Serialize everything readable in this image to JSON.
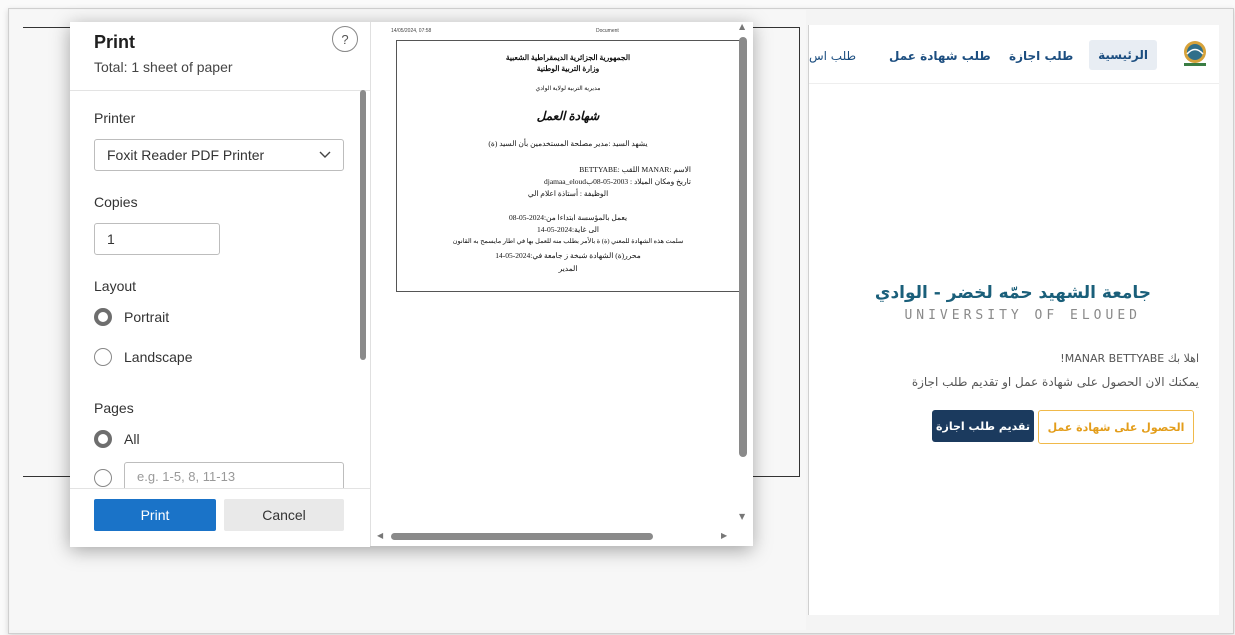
{
  "website": {
    "nav": {
      "home": "الرئيسية",
      "leave_request": "طلب اجازة",
      "work_certificate": "طلب شهادة عمل",
      "truncated_item": "طلب اس"
    },
    "university_name_ar": "جامعة الشهيد حمّه لخضر - الوادي",
    "university_name_en": "UNIVERSITY OF ELOUED",
    "welcome": "اهلا بك MANAR BETTYABE!",
    "subtext": "يمكنك الان الحصول على شهادة عمل او تقديم طلب اجازة",
    "btn_certificate": "الحصول على شهادة عمل",
    "btn_leave": "تقديم طلب اجازة"
  },
  "print_dialog": {
    "title": "Print",
    "total": "Total: 1 sheet of paper",
    "help": "?",
    "printer_label": "Printer",
    "printer_value": "Foxit Reader PDF Printer",
    "copies_label": "Copies",
    "copies_value": "1",
    "layout_label": "Layout",
    "layout_options": [
      "Portrait",
      "Landscape"
    ],
    "layout_selected": "Portrait",
    "pages_label": "Pages",
    "pages_all": "All",
    "pages_placeholder": "e.g. 1-5, 8, 11-13",
    "print_button": "Print",
    "cancel_button": "Cancel"
  },
  "preview": {
    "header_left": "14/05/2024, 07:58",
    "header_center": "Document",
    "lines": [
      "الجمهورية الجزائرية الديمقراطية الشعبية",
      "وزارة التربية الوطنية",
      "مديرية التربية لولاية الوادي",
      "شهادة العمل",
      "يشهد السيد :مدير مصلحة المستخدمين بأن السيد (ة)",
      "الاسم :MANAR اللقب :BETTYABE",
      "تاريخ ومكان الميلاد : 2003-05-08بdjamaa_eloud",
      "الوظيفة : أستاذة اعلام الي",
      "يعمل بالمؤسسة ابتداءا من:2024-05-08",
      "الى غاية:2024-05-14",
      "سلمت هذه الشهادة للمعني (ة) ة بالأمر بطلب منه للعمل بها في اطار مايسمح به القانون",
      "محرر(ة) الشهادة شبخة ز جامعة في:2024-05-14",
      "المدير"
    ]
  }
}
